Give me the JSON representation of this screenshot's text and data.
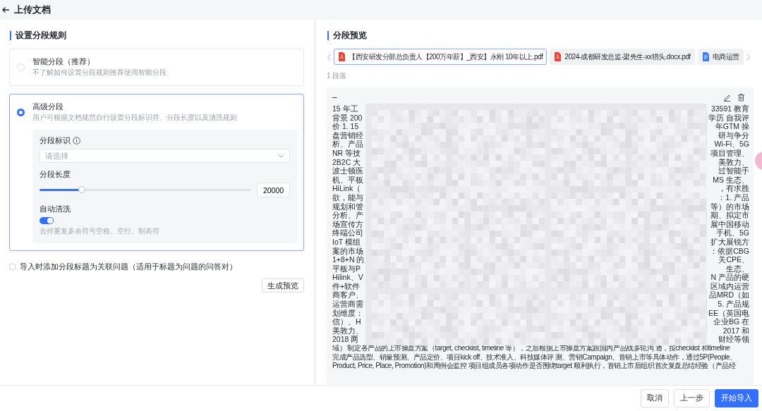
{
  "header": {
    "title": "上传文档"
  },
  "rules": {
    "heading": "设置分段规则",
    "options": [
      {
        "title": "智能分段（推荐）",
        "description": "不了解如何设置分段规则推荐使用智能分段",
        "selected": false
      },
      {
        "title": "高级分段",
        "description": "用户可根据文档规范自行设置分段标识符、分段长度以及清洗规则",
        "selected": true,
        "settings": {
          "identifier": {
            "label": "分段标识",
            "placeholder": "请选择"
          },
          "length": {
            "label": "分段长度",
            "level": 0.2,
            "value": "20000"
          },
          "auto_clean": {
            "label": "自动清洗",
            "on": true,
            "hint": "去掉重复多余符号空格、空行、制表符"
          }
        }
      }
    ],
    "add_title_question": {
      "label": "导入时添加分段标题为关联问题（适用于标题为问题的问答对）",
      "checked": false
    },
    "preview_button": "生成预览"
  },
  "preview": {
    "heading": "分段预览",
    "files": [
      {
        "name": "【西安研发分部总负责人【200万年薪】_西安】永刚 10年以上.pdf",
        "kind": "pdf",
        "selected": true
      },
      {
        "name": "2024-成都研发总监-梁先生-xx猎头.docx.pdf",
        "kind": "pdf",
        "selected": false
      },
      {
        "name": "电商运营",
        "kind": "word",
        "selected": false
      }
    ],
    "paragraph_count": "1 段落",
    "segment": {
      "title": "–",
      "lines": [
        {
          "kind": "split",
          "left": "15 年工",
          "right": "33591 教育"
        },
        {
          "kind": "split",
          "left": "背景 200",
          "right": "学历 自我评"
        },
        {
          "kind": "split",
          "left": "价 1. 15",
          "right": "年GTM 操"
        },
        {
          "kind": "split",
          "left": "盘营销经",
          "right": "研与争分"
        },
        {
          "kind": "split",
          "left": "析、产品",
          "right": "Wi-Fi、5G"
        },
        {
          "kind": "split",
          "left": "NR 等技",
          "right": "项目管理、"
        },
        {
          "kind": "split",
          "left": "2B2C 大",
          "right": "美敦力、"
        },
        {
          "kind": "split",
          "left": "波士顿医",
          "right": "过智能手"
        },
        {
          "kind": "split",
          "left": "机、平板",
          "right": "MS 生态、"
        },
        {
          "kind": "split",
          "left": "HiLink（",
          "right": "，有求胜"
        },
        {
          "kind": "split",
          "left": "欲，能与",
          "right": "：1. 产品"
        },
        {
          "kind": "split",
          "left": "规划和管",
          "right": "等）的市场"
        },
        {
          "kind": "split",
          "left": "分析、产",
          "right": "期、拟定市"
        },
        {
          "kind": "split",
          "left": "场宣传方",
          "right": "展中国移动"
        },
        {
          "kind": "split",
          "left": "终端公司",
          "right": "手机、5G"
        },
        {
          "kind": "split",
          "left": "IoT 模组",
          "right": "扩大展锐方"
        },
        {
          "kind": "split",
          "left": "案的市场",
          "right": "：依据CBG"
        },
        {
          "kind": "split",
          "left": "1+8+N 的",
          "right": "关CPE、"
        },
        {
          "kind": "split",
          "left": "平板与P",
          "right": "生态、"
        },
        {
          "kind": "split",
          "left": "Hilink、V",
          "right": "N 产品的硬"
        },
        {
          "kind": "split",
          "left": "件+软件",
          "right": "区域内运营"
        },
        {
          "kind": "split",
          "left": "商客户、",
          "right": "品MRD（如"
        },
        {
          "kind": "split",
          "left": "运营商需",
          "right": "5. 产品规"
        },
        {
          "kind": "split",
          "left": "划维度：",
          "right": "EE（英国电"
        },
        {
          "kind": "split",
          "left": "信）、H",
          "right": "企业BG 在"
        },
        {
          "kind": "split",
          "left": "美敦力、",
          "right": "2017 和"
        },
        {
          "kind": "split",
          "left": "2018 两",
          "right": "财经等领"
        },
        {
          "kind": "full",
          "text": "域） 制定各产品的上市操盘方案（target, checklist, timeline 等），之后根据上市操盘方案跟国内产品线多轮沟 通，按checklist 和timeline"
        },
        {
          "kind": "full",
          "text": "完成产品选型、销量预测、产品定价、项目kick off、技术准入、科技媒体评 测、营销Campaign、首销上市等具体动作，通过5P(People、"
        },
        {
          "kind": "full",
          "text": "Product, Price, Place, Promotion)和周例会监控 项目组成员各项动作是否围绕target 顺利执行，首销上市后组织首次复盘总结经验（产品经"
        }
      ]
    }
  },
  "footer_buttons": [
    {
      "label": "取消",
      "kind": "default"
    },
    {
      "label": "上一步",
      "kind": "default"
    },
    {
      "label": "开始导入",
      "kind": "primary"
    }
  ]
}
